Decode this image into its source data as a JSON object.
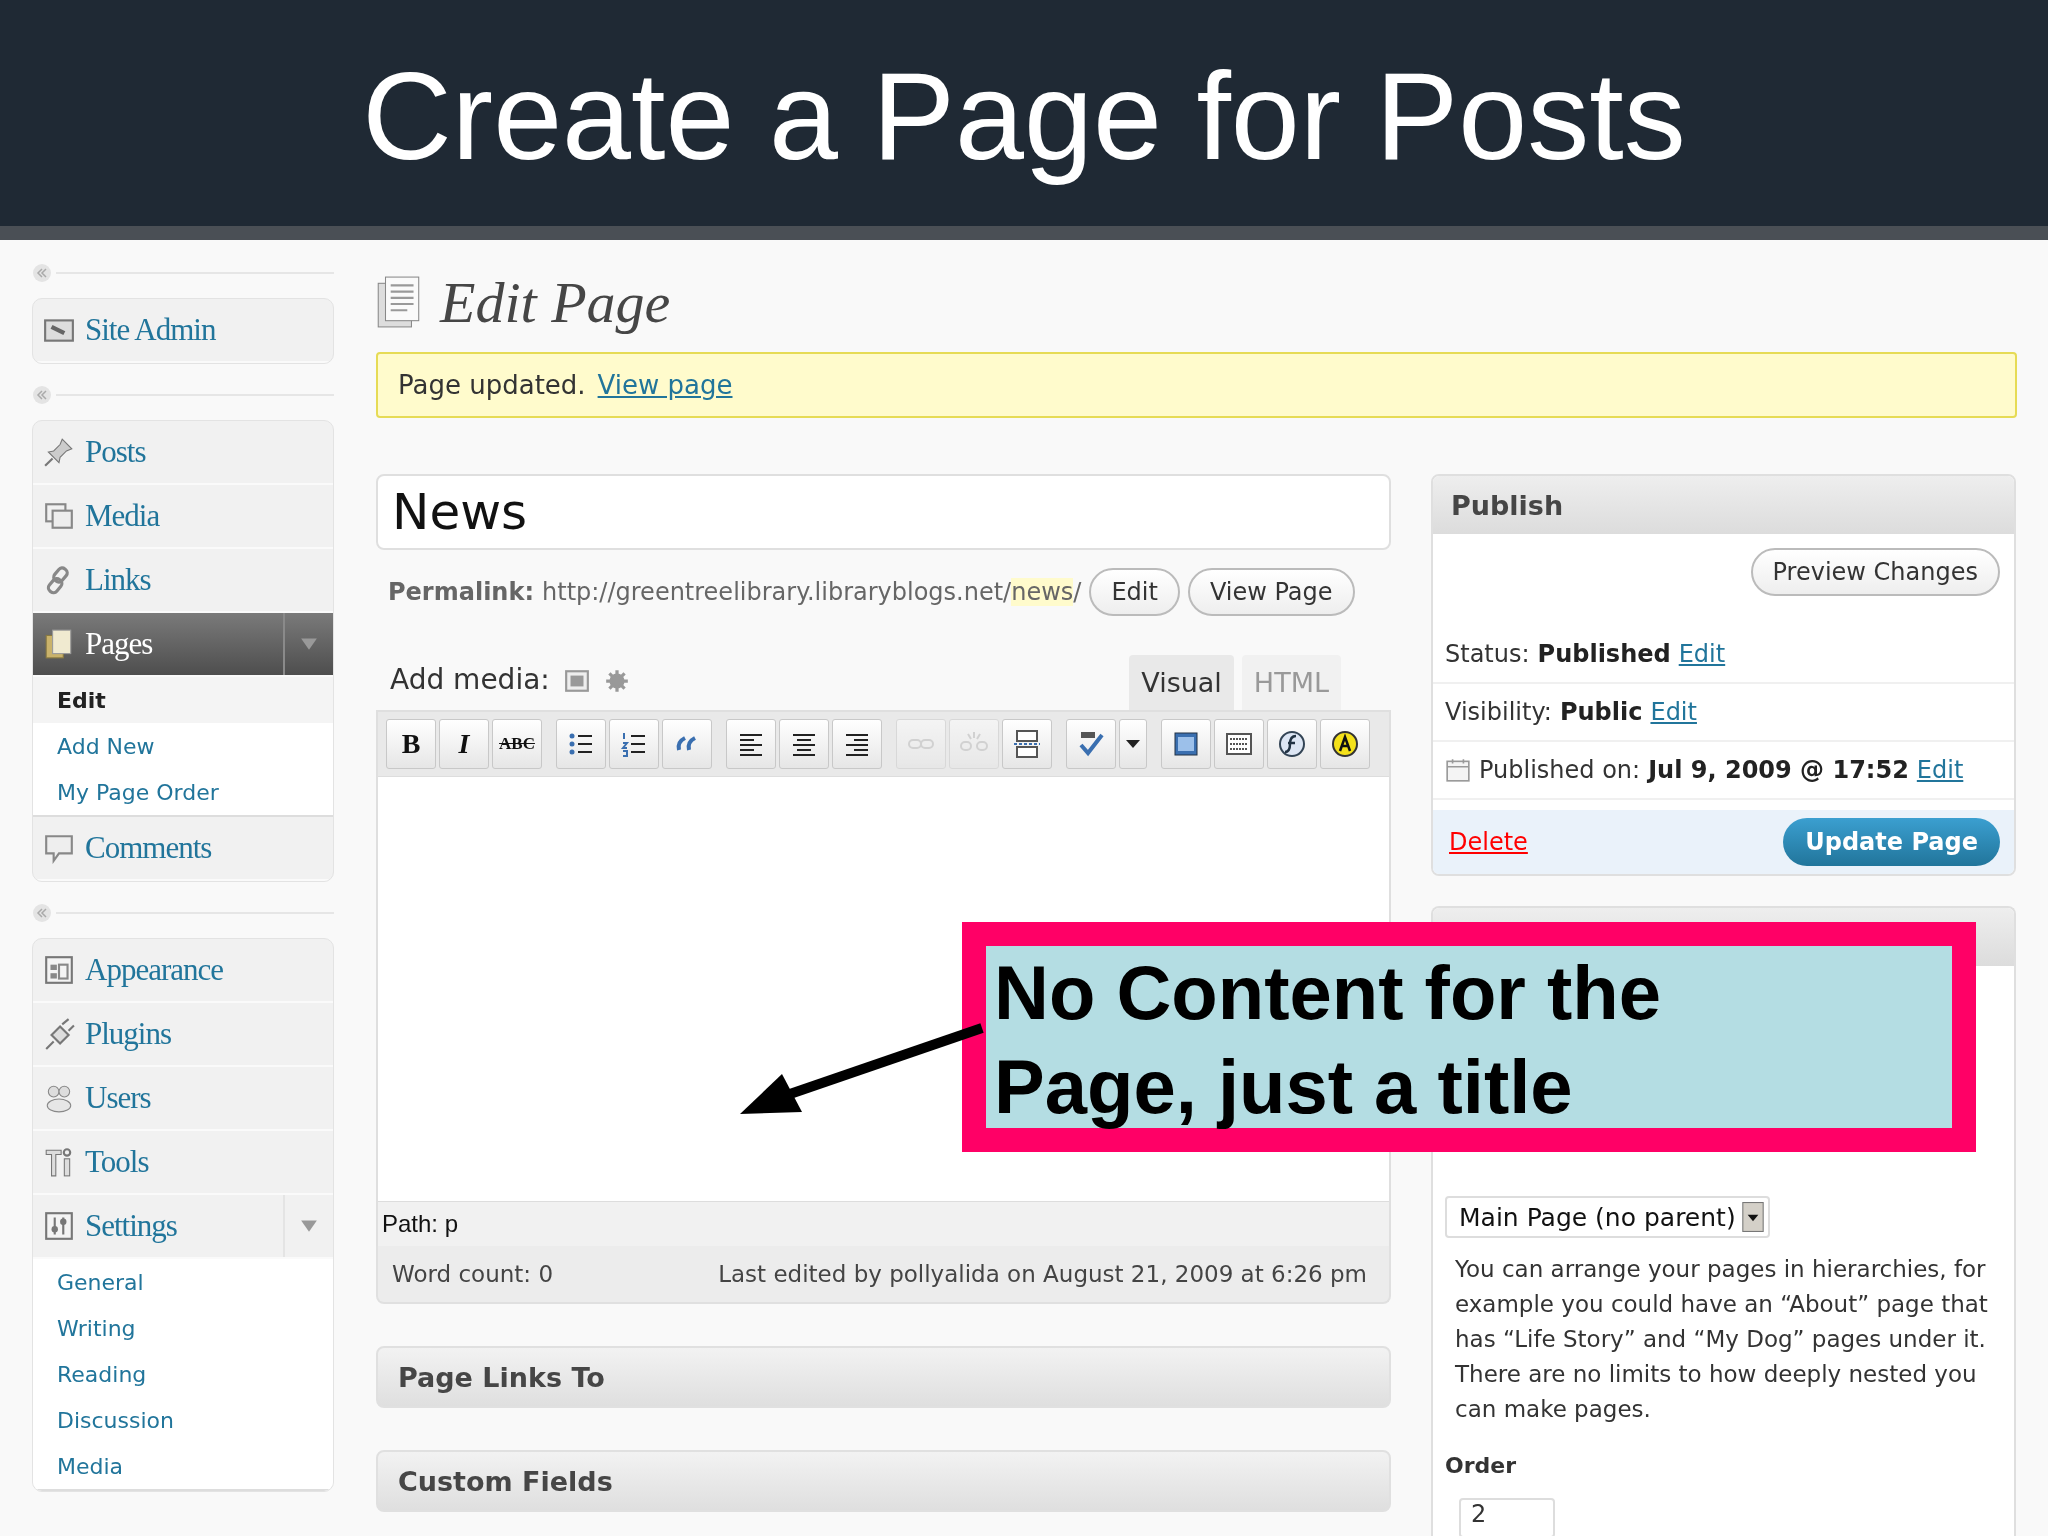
{
  "slide": {
    "title": "Create a Page for Posts"
  },
  "sidebar": {
    "groups": [
      {
        "items": [
          {
            "label": "Site Admin",
            "selected": false
          }
        ]
      },
      {
        "items": [
          {
            "label": "Posts",
            "selected": false
          },
          {
            "label": "Media",
            "selected": false
          },
          {
            "label": "Links",
            "selected": false
          },
          {
            "label": "Pages",
            "selected": true,
            "expanded": true,
            "children": [
              {
                "label": "Edit",
                "selected": true
              },
              {
                "label": "Add New",
                "selected": false
              },
              {
                "label": "My Page Order",
                "selected": false
              }
            ]
          },
          {
            "label": "Comments",
            "selected": false
          }
        ]
      },
      {
        "items": [
          {
            "label": "Appearance",
            "selected": false
          },
          {
            "label": "Plugins",
            "selected": false
          },
          {
            "label": "Users",
            "selected": false
          },
          {
            "label": "Tools",
            "selected": false
          },
          {
            "label": "Settings",
            "selected": false,
            "expanded": true,
            "children": [
              {
                "label": "General",
                "selected": false
              },
              {
                "label": "Writing",
                "selected": false
              },
              {
                "label": "Reading",
                "selected": false
              },
              {
                "label": "Discussion",
                "selected": false
              },
              {
                "label": "Media",
                "selected": false
              }
            ]
          }
        ]
      }
    ]
  },
  "page": {
    "heading": "Edit Page",
    "notice": {
      "text": "Page updated.",
      "link": "View page"
    }
  },
  "editor": {
    "title_value": "News",
    "permalink": {
      "label": "Permalink:",
      "url_prefix": "http://greentreelibrary.libraryblogs.net/",
      "slug": "news",
      "url_suffix": "/",
      "buttons": [
        "Edit",
        "View Page"
      ]
    },
    "add_media_label": "Add media:",
    "tabs": [
      {
        "label": "Visual",
        "selected": true
      },
      {
        "label": "HTML",
        "selected": false
      }
    ],
    "toolbar": [
      {
        "kind": "bold",
        "label": "B",
        "disabled": false
      },
      {
        "kind": "italic",
        "label": "I",
        "disabled": false
      },
      {
        "kind": "strike",
        "label": "ABC",
        "disabled": false
      },
      {
        "kind": "icon",
        "disabled": false
      },
      {
        "kind": "icon",
        "disabled": false
      },
      {
        "kind": "icon",
        "disabled": false
      },
      {
        "kind": "icon",
        "disabled": false
      },
      {
        "kind": "icon",
        "disabled": false
      },
      {
        "kind": "icon",
        "disabled": false
      },
      {
        "kind": "icon",
        "disabled": true
      },
      {
        "kind": "icon",
        "disabled": true
      },
      {
        "kind": "icon",
        "disabled": false
      },
      {
        "kind": "icon",
        "disabled": false
      },
      {
        "kind": "icon",
        "disabled": false
      },
      {
        "kind": "icon",
        "disabled": false
      },
      {
        "kind": "icon",
        "disabled": false
      },
      {
        "kind": "icon",
        "disabled": false
      },
      {
        "kind": "icon",
        "disabled": false
      }
    ],
    "path": "Path: p",
    "word_count": "Word count: 0",
    "last_edited": "Last edited by pollyalida on August 21, 2009 at 6:26 pm"
  },
  "boxes": [
    {
      "title": "Page Links To"
    },
    {
      "title": "Custom Fields"
    }
  ],
  "publish": {
    "title": "Publish",
    "preview_button": "Preview Changes",
    "rows": [
      {
        "kind": "plain",
        "label": "Status:",
        "value": "Published",
        "link": "Edit"
      },
      {
        "kind": "plain",
        "label": "Visibility:",
        "value": "Public",
        "link": "Edit"
      },
      {
        "kind": "date",
        "label": "Published on:",
        "value": "Jul 9, 2009 @ 17:52",
        "link": "Edit"
      }
    ],
    "delete_link": "Delete",
    "update_button": "Update Page"
  },
  "attributes": {
    "parent_select": "Main Page (no parent)",
    "help": "You can arrange your pages in hierarchies, for example you could have an “About” page that has “Life Story” and “My Dog” pages under it. There are no limits to how deeply nested you can make pages.",
    "order_label": "Order",
    "order_value": "2"
  },
  "callout": {
    "text": "No Content for the Page, just a title"
  }
}
